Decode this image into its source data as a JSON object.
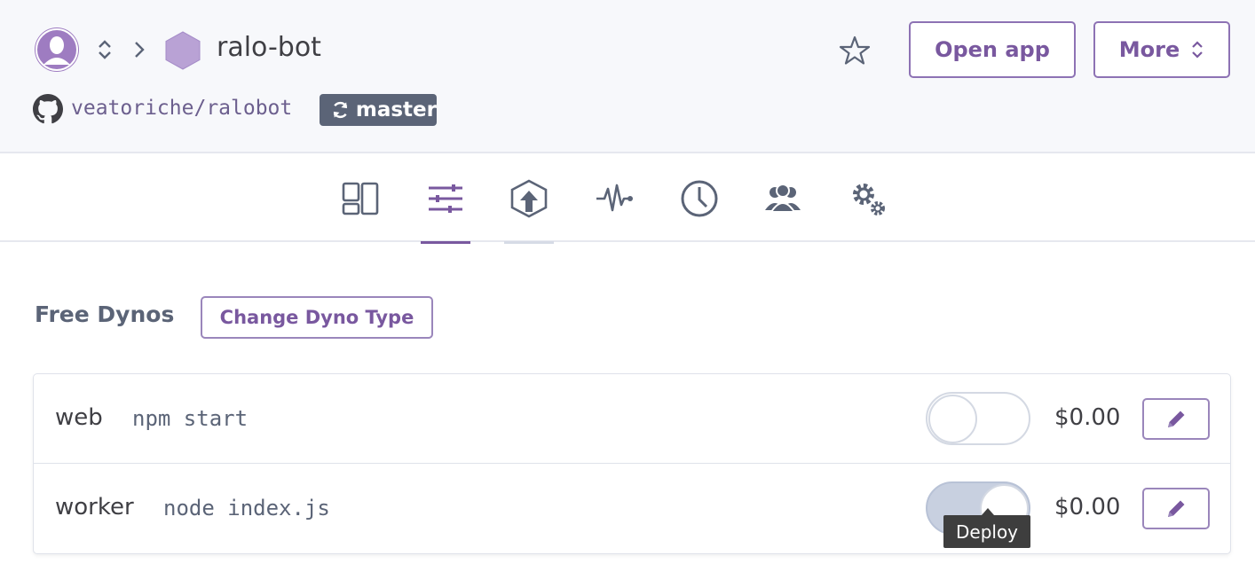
{
  "header": {
    "app_name": "ralo-bot",
    "repo": "veatoriche/ralobot",
    "branch": "master",
    "open_app_label": "Open app",
    "more_label": "More"
  },
  "nav": {
    "items": [
      {
        "icon": "overview-icon"
      },
      {
        "icon": "resources-icon",
        "active": true
      },
      {
        "icon": "deploy-icon"
      },
      {
        "icon": "metrics-icon"
      },
      {
        "icon": "activity-icon"
      },
      {
        "icon": "access-icon"
      },
      {
        "icon": "settings-icon"
      }
    ]
  },
  "main": {
    "section_title": "Free Dynos",
    "change_dyno_label": "Change Dyno Type",
    "dynos": [
      {
        "type": "web",
        "command": "npm start",
        "enabled": false,
        "price": "$0.00"
      },
      {
        "type": "worker",
        "command": "node index.js",
        "enabled": true,
        "price": "$0.00"
      }
    ],
    "tooltip": "Deploy"
  },
  "colors": {
    "accent": "#79589f",
    "header_bg": "#f7f8fb",
    "branch_bg": "#5b6477"
  }
}
